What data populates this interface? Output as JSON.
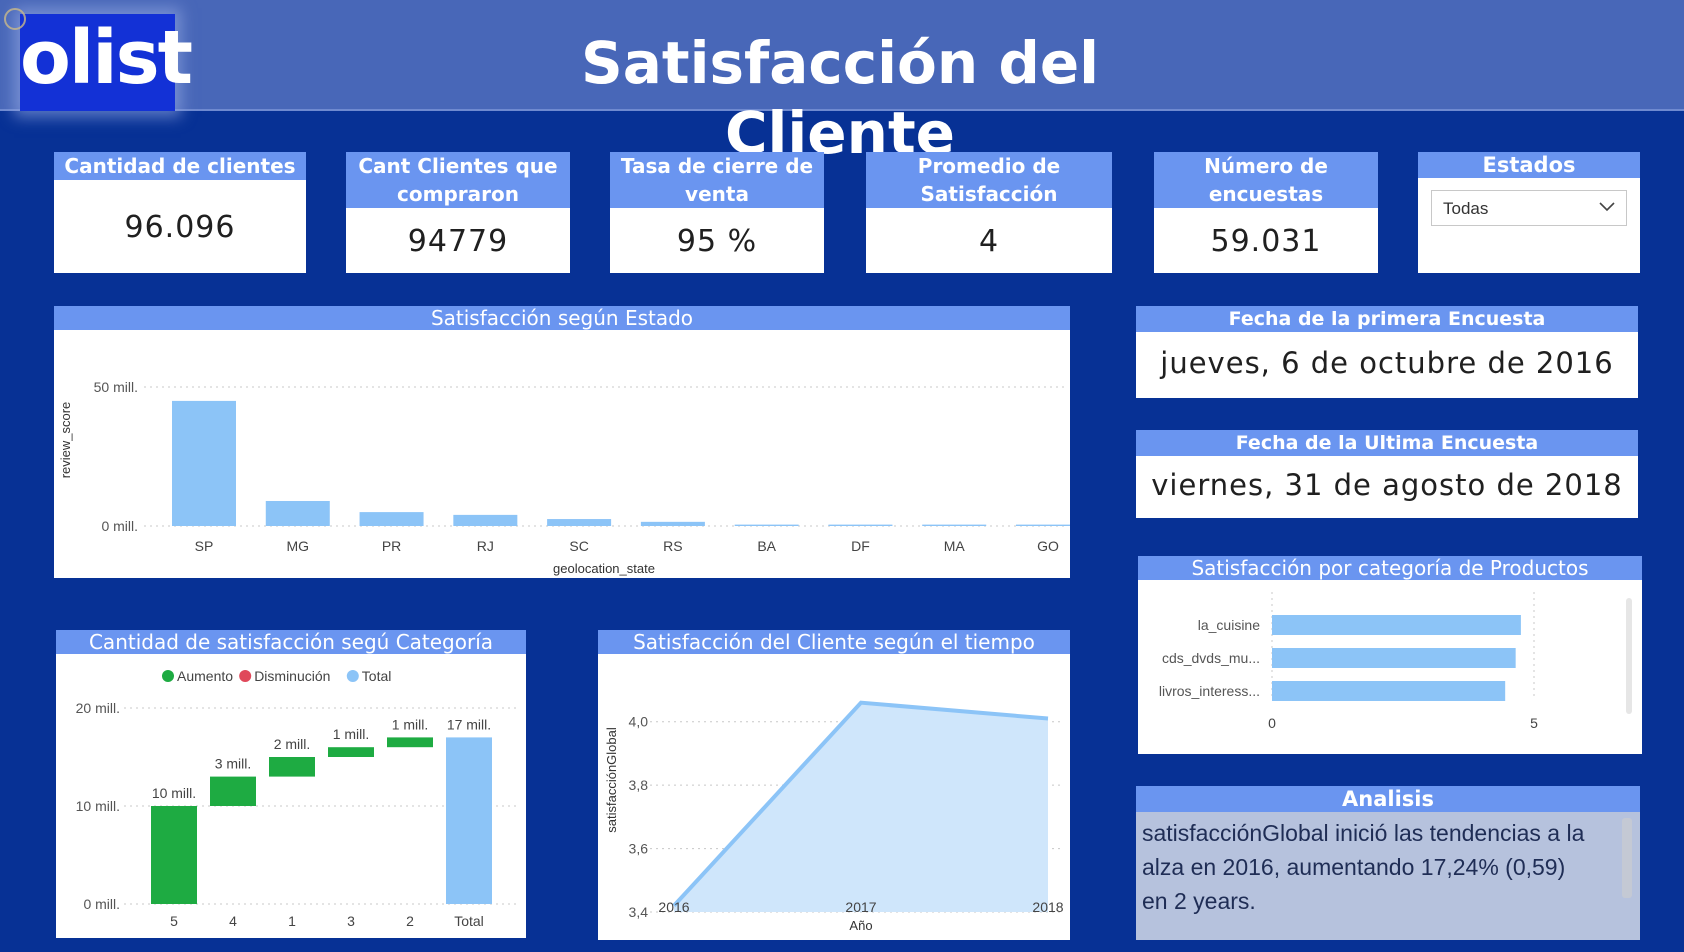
{
  "header": {
    "logo_text": "olist",
    "title": "Satisfacción del Cliente"
  },
  "kpis": {
    "clientes": {
      "label": "Cantidad de clientes",
      "value": "96.096"
    },
    "compraron": {
      "label": "Cant Clientes que compraron",
      "value": "94779"
    },
    "tasa": {
      "label": "Tasa de cierre de venta",
      "value": "95 %"
    },
    "promedio": {
      "label": "Promedio de Satisfacción",
      "value": "4"
    },
    "encuestas": {
      "label": "Número de encuestas",
      "value": "59.031"
    }
  },
  "estados": {
    "title": "Estados",
    "selected": "Todas",
    "icon": "chevron-down-icon"
  },
  "fechas": {
    "primera": {
      "label": "Fecha de la primera Encuesta",
      "value": "jueves, 6 de octubre de 2016"
    },
    "ultima": {
      "label": "Fecha de la Ultima Encuesta",
      "value": "viernes, 31 de agosto de 2018"
    }
  },
  "analisis": {
    "title": "Analisis",
    "text": "satisfacciónGlobal inició las tendencias a la alza en 2016, aumentando 17,24% (0,59) en 2 years."
  },
  "chart_data": [
    {
      "id": "estado",
      "type": "bar",
      "title": "Satisfacción según Estado",
      "xlabel": "geolocation_state",
      "ylabel": "review_score",
      "categories": [
        "SP",
        "MG",
        "PR",
        "RJ",
        "SC",
        "RS",
        "BA",
        "DF",
        "MA",
        "GO"
      ],
      "values": [
        45,
        9,
        5,
        4,
        2.5,
        1.5,
        0.5,
        0.5,
        0.5,
        0.5
      ],
      "ylim": [
        0,
        50
      ],
      "yticks": [
        {
          "v": 0,
          "label": "0 mill."
        },
        {
          "v": 50,
          "label": "50 mill."
        }
      ],
      "color": "#8cc4f7",
      "grid": true
    },
    {
      "id": "cascada",
      "type": "bar",
      "subtype": "waterfall",
      "title": "Cantidad de satisfacción segú Categoría",
      "legend": [
        "Aumento",
        "Disminución",
        "Total"
      ],
      "legend_colors": [
        "#1eab42",
        "#e0485a",
        "#8cc4f7"
      ],
      "categories": [
        "5",
        "4",
        "1",
        "3",
        "2",
        "Total"
      ],
      "values": [
        10,
        3,
        2,
        1,
        1,
        17
      ],
      "labels": [
        "10 mill.",
        "3 mill.",
        "2 mill.",
        "1 mill.",
        "1 mill.",
        "17 mill."
      ],
      "ylim": [
        0,
        20
      ],
      "yticks": [
        {
          "v": 0,
          "label": "0 mill."
        },
        {
          "v": 10,
          "label": "10 mill."
        },
        {
          "v": 20,
          "label": "20 mill."
        }
      ],
      "grid": true
    },
    {
      "id": "tiempo",
      "type": "area",
      "title": "Satisfacción del Cliente según el tiempo",
      "xlabel": "Año",
      "ylabel": "satisfacciónGlobal",
      "x": [
        "2016",
        "2017",
        "2018"
      ],
      "values": [
        3.42,
        4.06,
        4.01
      ],
      "ylim": [
        3.4,
        4.1
      ],
      "yticks": [
        {
          "v": 3.4,
          "label": "3,4"
        },
        {
          "v": 3.6,
          "label": "3,6"
        },
        {
          "v": 3.8,
          "label": "3,8"
        },
        {
          "v": 4.0,
          "label": "4,0"
        }
      ],
      "line_color": "#8cc4f7",
      "fill_color": "#cfe6fb",
      "grid": true
    },
    {
      "id": "categoria",
      "type": "bar",
      "orientation": "horizontal",
      "title": "Satisfacción por categoría de Productos",
      "categories": [
        "la_cuisine",
        "cds_dvds_mu...",
        "livros_interess..."
      ],
      "values": [
        4.75,
        4.65,
        4.45
      ],
      "xlim": [
        0,
        5
      ],
      "xticks": [
        {
          "v": 0,
          "label": "0"
        },
        {
          "v": 5,
          "label": "5"
        }
      ],
      "color": "#8cc4f7",
      "grid": true
    }
  ]
}
